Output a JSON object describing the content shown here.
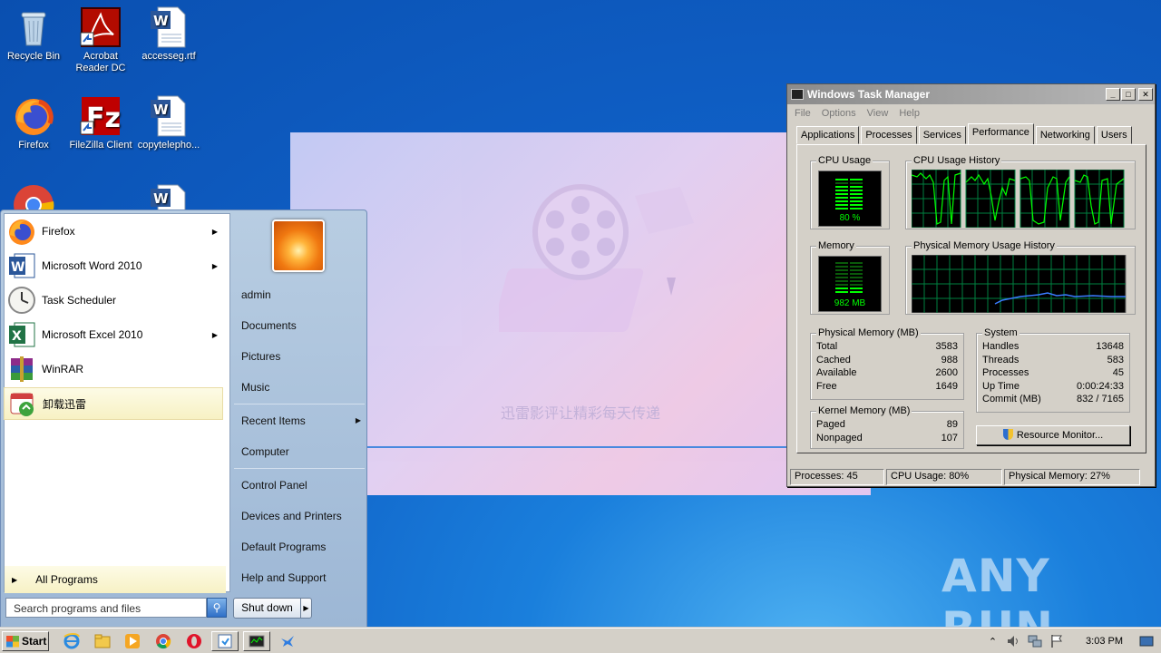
{
  "desktop": {
    "icons": [
      {
        "label": "Recycle Bin"
      },
      {
        "label": "Acrobat Reader DC"
      },
      {
        "label": "accesseg.rtf"
      },
      {
        "label": "Firefox"
      },
      {
        "label": "FileZilla Client"
      },
      {
        "label": "copytelepho..."
      }
    ]
  },
  "splash": {
    "slogan": "迅雷影评让精彩每天传递"
  },
  "start_menu": {
    "programs": [
      {
        "label": "Firefox",
        "has_arrow": true
      },
      {
        "label": "Microsoft Word 2010",
        "has_arrow": true
      },
      {
        "label": "Task Scheduler",
        "has_arrow": false
      },
      {
        "label": "Microsoft Excel 2010",
        "has_arrow": true
      },
      {
        "label": "WinRAR",
        "has_arrow": false
      },
      {
        "label": "卸载迅雷",
        "has_arrow": false
      }
    ],
    "all_programs": "All Programs",
    "search_placeholder": "Search programs and files",
    "right_items": {
      "admin": "admin",
      "documents": "Documents",
      "pictures": "Pictures",
      "music": "Music",
      "recent_items": "Recent Items",
      "computer": "Computer",
      "control_panel": "Control Panel",
      "devices_printers": "Devices and Printers",
      "default_programs": "Default Programs",
      "help_support": "Help and Support"
    },
    "shutdown": "Shut down"
  },
  "task_manager": {
    "title": "Windows Task Manager",
    "menu": [
      "File",
      "Options",
      "View",
      "Help"
    ],
    "tabs": [
      "Applications",
      "Processes",
      "Services",
      "Performance",
      "Networking",
      "Users"
    ],
    "active_tab": "Performance",
    "cpu_usage_title": "CPU Usage",
    "cpu_usage_value": "80 %",
    "cpu_history_title": "CPU Usage History",
    "memory_title": "Memory",
    "memory_value": "982 MB",
    "memory_history_title": "Physical Memory Usage History",
    "physical_memory": {
      "title": "Physical Memory (MB)",
      "rows": [
        {
          "label": "Total",
          "value": "3583"
        },
        {
          "label": "Cached",
          "value": "988"
        },
        {
          "label": "Available",
          "value": "2600"
        },
        {
          "label": "Free",
          "value": "1649"
        }
      ]
    },
    "system": {
      "title": "System",
      "rows": [
        {
          "label": "Handles",
          "value": "13648"
        },
        {
          "label": "Threads",
          "value": "583"
        },
        {
          "label": "Processes",
          "value": "45"
        },
        {
          "label": "Up Time",
          "value": "0:00:24:33"
        },
        {
          "label": "Commit (MB)",
          "value": "832 / 7165"
        }
      ]
    },
    "kernel_memory": {
      "title": "Kernel Memory (MB)",
      "rows": [
        {
          "label": "Paged",
          "value": "89"
        },
        {
          "label": "Nonpaged",
          "value": "107"
        }
      ]
    },
    "resource_monitor": "Resource Monitor...",
    "status": {
      "processes": "Processes: 45",
      "cpu": "CPU Usage: 80%",
      "memory": "Physical Memory: 27%"
    }
  },
  "taskbar": {
    "start": "Start",
    "clock": "3:03 PM"
  },
  "watermark": "ANY RUN"
}
